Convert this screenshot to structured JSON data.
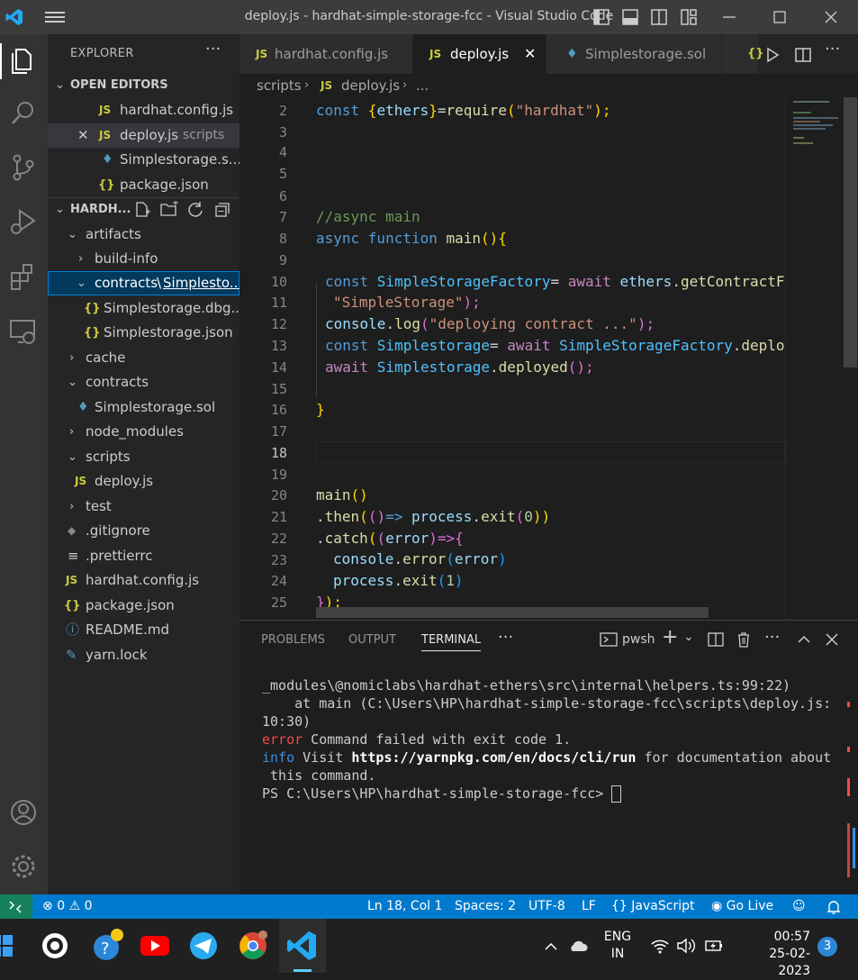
{
  "window": {
    "title": "deploy.js - hardhat-simple-storage-fcc - Visual Studio Code"
  },
  "sidebar": {
    "header": "EXPLORER",
    "more": "···",
    "open_editors": {
      "title": "OPEN EDITORS",
      "items": [
        {
          "icon": "JS",
          "name": "hardhat.config.js",
          "extra": ""
        },
        {
          "icon": "JS",
          "name": "deploy.js",
          "extra": "scripts"
        },
        {
          "icon": "eth",
          "name": "Simplestorage.s...",
          "extra": ""
        },
        {
          "icon": "{}",
          "name": "package.json",
          "extra": ""
        }
      ]
    },
    "workspace": {
      "title": "HARDH...",
      "tree": [
        {
          "name": "artifacts"
        },
        {
          "name": "build-info"
        },
        {
          "name": "contracts",
          "path_sep": "\\",
          "path_tail": "Simplesto..."
        },
        {
          "name": "Simplestorage.dbg..."
        },
        {
          "name": "Simplestorage.json"
        },
        {
          "name": "cache"
        },
        {
          "name": "contracts"
        },
        {
          "name": "Simplestorage.sol"
        },
        {
          "name": "node_modules"
        },
        {
          "name": "scripts"
        },
        {
          "name": "deploy.js"
        },
        {
          "name": "test"
        },
        {
          "name": ".gitignore"
        },
        {
          "name": ".prettierrc"
        },
        {
          "name": "hardhat.config.js"
        },
        {
          "name": "package.json"
        },
        {
          "name": "README.md"
        },
        {
          "name": "yarn.lock"
        }
      ]
    }
  },
  "tabs": [
    {
      "icon": "JS",
      "label": "hardhat.config.js"
    },
    {
      "icon": "JS",
      "label": "deploy.js",
      "close": "✕"
    },
    {
      "icon": "eth",
      "label": "Simplestorage.sol"
    },
    {
      "icon": "{}",
      "label": ""
    }
  ],
  "breadcrumb": {
    "folder": "scripts",
    "icon": "JS",
    "file": "deploy.js",
    "more": "..."
  },
  "editor": {
    "lines": [
      {
        "n": "2"
      },
      {
        "n": "3"
      },
      {
        "n": "4"
      },
      {
        "n": "5"
      },
      {
        "n": "6"
      },
      {
        "n": "7"
      },
      {
        "n": "8"
      },
      {
        "n": "9"
      },
      {
        "n": "10"
      },
      {
        "n": "11"
      },
      {
        "n": "12"
      },
      {
        "n": "13"
      },
      {
        "n": "14"
      },
      {
        "n": "15"
      },
      {
        "n": "16"
      },
      {
        "n": "17"
      },
      {
        "n": "18"
      },
      {
        "n": "19"
      },
      {
        "n": "20"
      },
      {
        "n": "21"
      },
      {
        "n": "22"
      },
      {
        "n": "23"
      },
      {
        "n": "24"
      },
      {
        "n": "25"
      }
    ],
    "code": {
      "l2a": "const ",
      "l2b": "{",
      "l2c": "ethers",
      "l2d": "}",
      "l2e": "=",
      "l2f": "require",
      "l2g": "(",
      "l2h": "\"hardhat\"",
      "l2i": ");",
      "l7": "//async main",
      "l8a": "async function ",
      "l8b": "main",
      "l8c": "(){",
      "l10a": "const ",
      "l10b": "SimpleStorageFactory",
      "l10c": "= ",
      "l10d": "await ",
      "l10e": "ethers",
      "l10f": ".",
      "l10g": "getContractF",
      "l11a": "\"SimpleStorage\"",
      "l11b": ");",
      "l12a": "console",
      "l12b": ".",
      "l12c": "log",
      "l12d": "(",
      "l12e": "\"deploying contract ...\"",
      "l12f": ");",
      "l13a": "const ",
      "l13b": "Simplestorage",
      "l13c": "= ",
      "l13d": "await ",
      "l13e": "SimpleStorageFactory",
      "l13f": ".",
      "l13g": "deploy",
      "l14a": "await ",
      "l14b": "Simplestorage",
      "l14c": ".",
      "l14d": "deployed",
      "l14e": "();",
      "l16": "}",
      "l20a": "main",
      "l20b": "()",
      "l21a": ".",
      "l21b": "then",
      "l21c": "(",
      "l21d": "()",
      "l21e": "=> ",
      "l21f": "process",
      "l21g": ".",
      "l21h": "exit",
      "l21i": "(",
      "l21j": "0",
      "l21k": "))",
      "l22a": ".",
      "l22b": "catch",
      "l22c": "(",
      "l22d": "(",
      "l22e": "error",
      "l22f": ")",
      "l22g": "=>{",
      "l23a": "console",
      "l23b": ".",
      "l23c": "error",
      "l23d": "(",
      "l23e": "error",
      "l23f": ")",
      "l24a": "process",
      "l24b": ".",
      "l24c": "exit",
      "l24d": "(",
      "l24e": "1",
      "l24f": ")",
      "l25a": "}",
      "l25b": ");"
    }
  },
  "panel": {
    "tabs": [
      "PROBLEMS",
      "OUTPUT",
      "TERMINAL"
    ],
    "more": "···",
    "shell": "pwsh",
    "terminal": {
      "t1": "_modules\\@nomiclabs\\hardhat-ethers\\src\\internal\\helpers.ts:99:22)",
      "t2": "    at main (C:\\Users\\HP\\hardhat-simple-storage-fcc\\scripts\\deploy.js:",
      "t3": "10:30)",
      "t4a": "error",
      "t4b": " Command failed with exit code 1.",
      "t5a": "info",
      "t5b": " Visit ",
      "t5c": "https://yarnpkg.com/en/docs/cli/run",
      "t5d": " for documentation about",
      "t6": " this command.",
      "t7": "PS C:\\Users\\HP\\hardhat-simple-storage-fcc> "
    }
  },
  "status": {
    "errors": "0",
    "warnings": "0",
    "position": "Ln 18, Col 1",
    "spaces": "Spaces: 2",
    "encoding": "UTF-8",
    "eol": "LF",
    "language": "JavaScript",
    "golive": "Go Live"
  },
  "taskbar": {
    "lang1": "ENG",
    "lang2": "IN",
    "time": "00:57",
    "date": "25-02-2023",
    "notifications": "3"
  },
  "colors": {
    "accent": "#007acc",
    "keyword": "#569cd6",
    "string": "#ce9178",
    "function": "#dcdcaa",
    "variable": "#9cdcfe",
    "comment": "#6a9955",
    "number": "#b5cea8",
    "bracket1": "#ffd700",
    "bracket2": "#da70d6",
    "bracket3": "#179fff",
    "keyword_await": "#c586c0",
    "js_icon": "#cbcb41",
    "error": "#f14c4c",
    "info": "#3b8eea"
  }
}
